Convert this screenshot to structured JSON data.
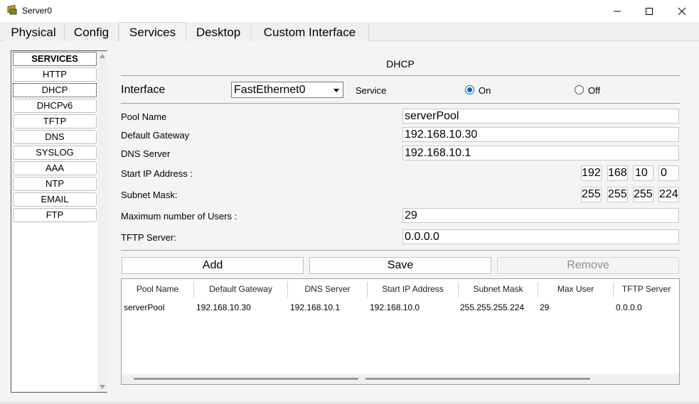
{
  "window": {
    "title": "Server0",
    "icon": "server-icon"
  },
  "tabs": [
    {
      "label": "Physical"
    },
    {
      "label": "Config"
    },
    {
      "label": "Services"
    },
    {
      "label": "Desktop"
    },
    {
      "label": "Custom Interface"
    }
  ],
  "services": {
    "header": "SERVICES",
    "items": [
      "HTTP",
      "DHCP",
      "DHCPv6",
      "TFTP",
      "DNS",
      "SYSLOG",
      "AAA",
      "NTP",
      "EMAIL",
      "FTP"
    ],
    "selected": "DHCP"
  },
  "dhcp": {
    "title": "DHCP",
    "interface_label": "Interface",
    "interface_value": "FastEthernet0",
    "service_label": "Service",
    "on_label": "On",
    "off_label": "Off",
    "service_state": "On",
    "pool_name_label": "Pool Name",
    "pool_name": "serverPool",
    "gateway_label": "Default Gateway",
    "gateway": "192.168.10.30",
    "dns_label": "DNS Server",
    "dns": "192.168.10.1",
    "start_ip_label": "Start IP Address :",
    "start_ip": [
      "192",
      "168",
      "10",
      "0"
    ],
    "mask_label": "Subnet Mask:",
    "mask": [
      "255",
      "255",
      "255",
      "224"
    ],
    "max_users_label": "Maximum number of Users :",
    "max_users": "29",
    "tftp_label": "TFTP Server:",
    "tftp": "0.0.0.0",
    "buttons": {
      "add": "Add",
      "save": "Save",
      "remove": "Remove"
    }
  },
  "pool_table": {
    "columns": [
      "Pool Name",
      "Default Gateway",
      "DNS Server",
      "Start IP Address",
      "Subnet Mask",
      "Max User",
      "TFTP Server"
    ],
    "rows": [
      [
        "serverPool",
        "192.168.10.30",
        "192.168.10.1",
        "192.168.10.0",
        "255.255.255.224",
        "29",
        "0.0.0.0"
      ]
    ]
  },
  "colors": {
    "radio_selected": "#0a64c8",
    "panel_bg": "#f4f4f4"
  }
}
